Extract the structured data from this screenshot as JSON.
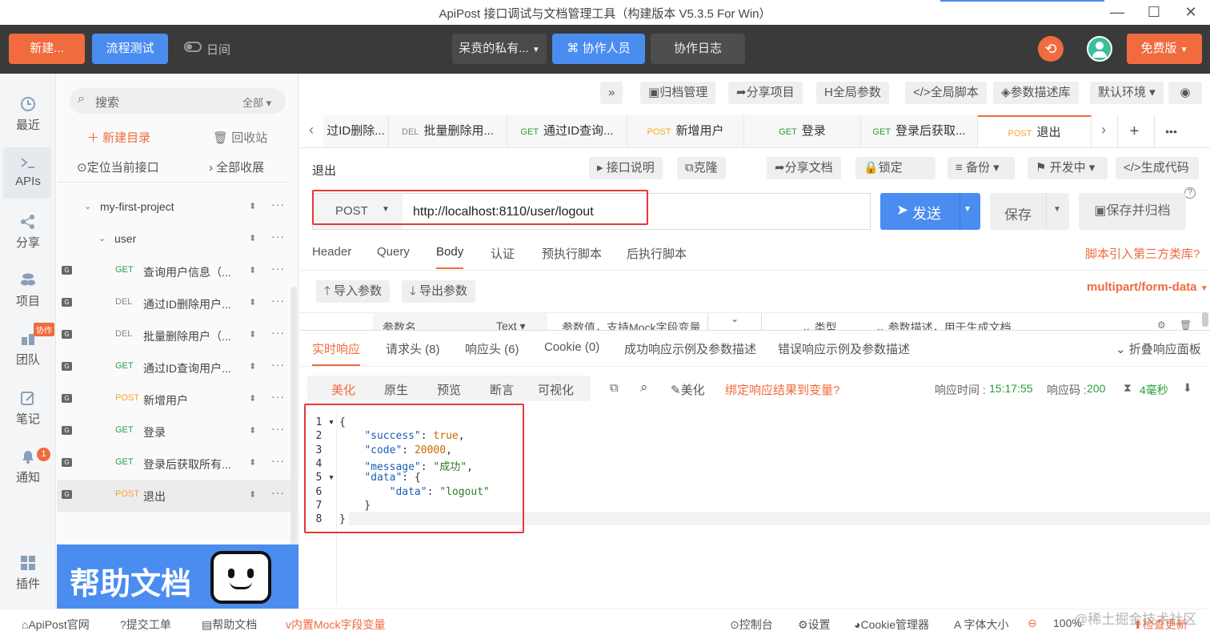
{
  "window": {
    "title": "ApiPost 接口调试与文档管理工具（构建版本 V5.3.5 For Win）"
  },
  "topbar": {
    "new_label": "新建...",
    "flow_test_label": "流程测试",
    "theme_label": "日间",
    "project_name": "呆贲的私有...",
    "collab_label": "协作人员",
    "collab_log_label": "协作日志",
    "plan_label": "免费版"
  },
  "rail": {
    "items": [
      {
        "label": "最近",
        "icon": "clock-icon"
      },
      {
        "label": "APIs",
        "icon": "terminal-icon"
      },
      {
        "label": "分享",
        "icon": "share-icon"
      },
      {
        "label": "项目",
        "icon": "layers-icon"
      },
      {
        "label": "团队",
        "icon": "team-icon",
        "badge": "协作"
      },
      {
        "label": "笔记",
        "icon": "note-icon"
      },
      {
        "label": "通知",
        "icon": "bell-icon",
        "badge": "1"
      },
      {
        "label": "插件",
        "icon": "grid-icon"
      }
    ]
  },
  "sidebar": {
    "search_placeholder": "搜索",
    "search_scope": "全部",
    "new_folder": "新建目录",
    "recycle": "回收站",
    "locate": "定位当前接口",
    "collapse": "全部收展",
    "project": "my-first-project",
    "folder": "user",
    "items": [
      {
        "method": "GET",
        "label": "查询用户信息（..."
      },
      {
        "method": "DEL",
        "label": "通过ID删除用户..."
      },
      {
        "method": "DEL",
        "label": "批量删除用户（..."
      },
      {
        "method": "GET",
        "label": "通过ID查询用户..."
      },
      {
        "method": "POST",
        "label": "新增用户"
      },
      {
        "method": "GET",
        "label": "登录"
      },
      {
        "method": "GET",
        "label": "登录后获取所有..."
      },
      {
        "method": "POST",
        "label": "退出"
      }
    ],
    "banner_text": "帮助文档"
  },
  "toolbar": {
    "expand": "»",
    "archive": "归档管理",
    "share_project": "分享项目",
    "global_params": "全局参数",
    "global_script": "全局脚本",
    "param_lib": "参数描述库",
    "env": "默认环境"
  },
  "tabs": [
    {
      "method": "",
      "label": "过ID删除..."
    },
    {
      "method": "DEL",
      "label": "批量删除用..."
    },
    {
      "method": "GET",
      "label": "通过ID查询..."
    },
    {
      "method": "POST",
      "label": "新增用户"
    },
    {
      "method": "GET",
      "label": "登录"
    },
    {
      "method": "GET",
      "label": "登录后获取..."
    },
    {
      "method": "POST",
      "label": "退出"
    }
  ],
  "request": {
    "name": "退出",
    "doc": "接口说明",
    "clone": "克隆",
    "share_doc": "分享文档",
    "lock": "锁定",
    "backup": "备份",
    "status": "开发中",
    "gen_code": "生成代码",
    "method": "POST",
    "url": "http://localhost:8110/user/logout",
    "send": "发送",
    "save": "保存",
    "save_archive": "保存并归档"
  },
  "req_tabs": {
    "items": [
      "Header",
      "Query",
      "Body",
      "认证",
      "预执行脚本",
      "后执行脚本"
    ],
    "active": "Body",
    "third_party": "脚本引入第三方类库?"
  },
  "body": {
    "import": "导入参数",
    "export": "导出参数",
    "content_type": "multipart/form-data",
    "col_name": "参数名",
    "col_type": "Text",
    "col_value": "参数值，支持Mock字段变量",
    "col_kind": "类型",
    "col_desc": "参数描述，用于生成文档"
  },
  "resp_tabs": {
    "items": [
      "实时响应",
      "请求头 (8)",
      "响应头 (6)",
      "Cookie (0)",
      "成功响应示例及参数描述",
      "错误响应示例及参数描述"
    ],
    "active": "实时响应",
    "fold": "折叠响应面板"
  },
  "resp_view": {
    "modes": [
      "美化",
      "原生",
      "预览",
      "断言",
      "可视化"
    ],
    "active": "美化",
    "beautify": "美化",
    "bind": "绑定响应结果到变量?",
    "time_label": "响应时间 :",
    "time": "15:17:55",
    "code_label": "响应码 :",
    "code": "200",
    "duration": "4毫秒"
  },
  "response_code": {
    "lines": [
      "{",
      "    \"success\": true,",
      "    \"code\": 20000,",
      "    \"message\": \"成功\",",
      "    \"data\": {",
      "        \"data\": \"logout\"",
      "    }",
      "}"
    ]
  },
  "statusbar": {
    "site": "ApiPost官网",
    "ticket": "提交工单",
    "help": "帮助文档",
    "mock": "内置Mock字段变量",
    "console": "控制台",
    "settings": "设置",
    "cookie": "Cookie管理器",
    "font": "字体大小",
    "zoom": "100%",
    "update": "检查更新",
    "watermark": "@稀土掘金技术社区"
  },
  "colors": {
    "orange": "#f06b3e",
    "blue": "#4a8cf0",
    "get": "#2a9d3a",
    "post": "#f5a623",
    "del": "#888888",
    "highlight_box": "#e53935"
  }
}
